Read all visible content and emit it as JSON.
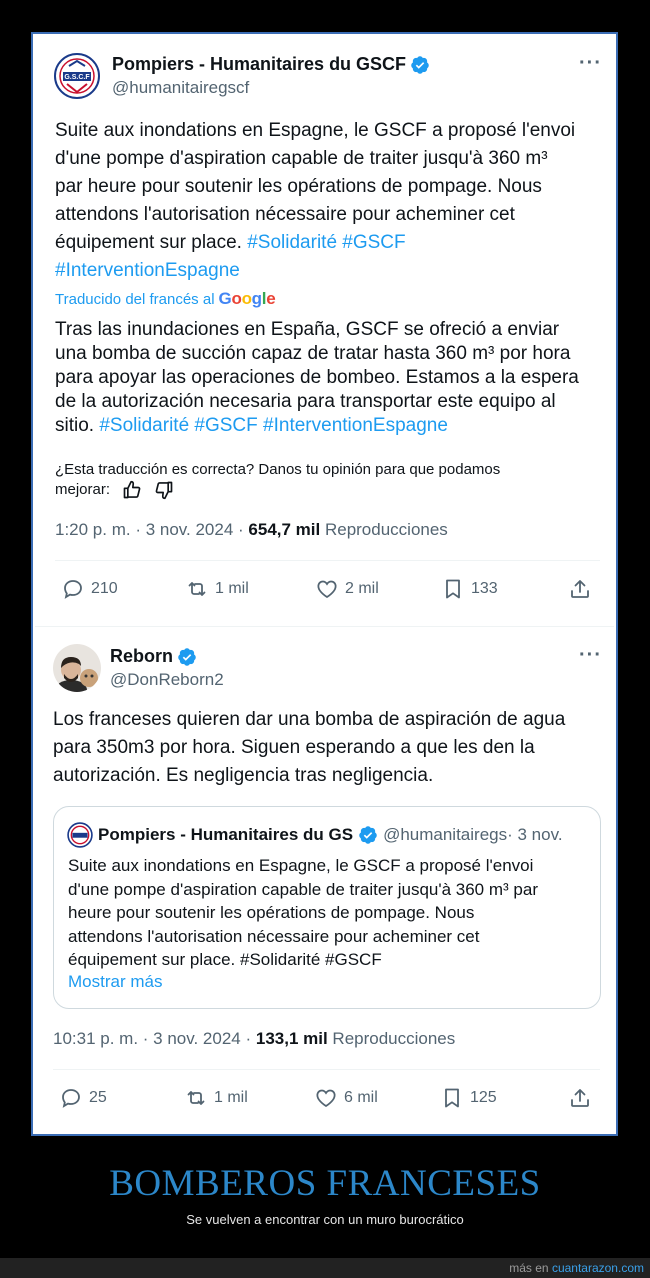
{
  "tweet1": {
    "name": "Pompiers - Humanitaires du GSCF",
    "handle": "@humanitairegscf",
    "more": "···",
    "text_lines": [
      "Suite aux inondations en Espagne, le GSCF a proposé l'envoi",
      "d'une pompe d'aspiration capable de traiter jusqu'à 360 m³",
      "par heure pour soutenir les opérations de pompage. Nous",
      "attendons l'autorisation nécessaire pour acheminer cet",
      "équipement sur place. "
    ],
    "hashtags_line5": "#Solidarité #GSCF",
    "hashtags_line6": "#InterventionEspagne",
    "translated_by": "Traducido del francés al",
    "google": [
      "G",
      "o",
      "o",
      "g",
      "l",
      "e"
    ],
    "translation_lines": [
      "Tras las inundaciones en España, GSCF se ofreció a enviar",
      "una bomba de succión capaz de tratar hasta 360 m³ por hora",
      "para apoyar las operaciones de bombeo. Estamos a la espera",
      "de la autorización necesaria para transportar este equipo al",
      "sitio. "
    ],
    "translation_hashtags": "#Solidarité #GSCF #InterventionEspagne",
    "feedback_line1": "¿Esta traducción es correcta? Danos tu opinión para que podamos",
    "feedback_line2": "mejorar:",
    "time": "1:20 p. m. · 3 nov. 2024 · ",
    "views": "654,7 mil",
    "views_label": " Reproducciones",
    "replies": "210",
    "reposts": "1 mil",
    "likes": "2 mil",
    "bookmarks": "133"
  },
  "tweet2": {
    "name": "Reborn",
    "handle": "@DonReborn2",
    "more": "···",
    "text_lines": [
      "Los franceses quieren dar una bomba de aspiración de agua",
      "para 350m3 por hora. Siguen esperando a que les den la",
      "autorización. Es negligencia tras negligencia."
    ],
    "quote": {
      "name": "Pompiers - Humanitaires du GS",
      "handle": "@humanitairegs",
      "date": " · 3 nov.",
      "text_lines": [
        "Suite aux inondations en Espagne, le GSCF a proposé l'envoi",
        "d'une pompe d'aspiration capable de traiter jusqu'à 360 m³ par",
        "heure pour soutenir les opérations de pompage. Nous",
        "attendons l'autorisation nécessaire pour acheminer cet",
        "équipement sur place. #Solidarité #GSCF"
      ],
      "show_more": "Mostrar más"
    },
    "time": "10:31 p. m. · 3 nov. 2024 · ",
    "views": "133,1 mil",
    "views_label": " Reproducciones",
    "replies": "25",
    "reposts": "1 mil",
    "likes": "6 mil",
    "bookmarks": "125"
  },
  "caption": {
    "title": "BOMBEROS FRANCESES",
    "subtitle": "Se vuelven a encontrar con un muro burocrático"
  },
  "footer": {
    "prefix": "más en ",
    "site": "cuantarazon.com"
  },
  "colors": {
    "accent": "#1d9bf0",
    "caption": "#2c87c9",
    "frame": "#3b6db5"
  }
}
